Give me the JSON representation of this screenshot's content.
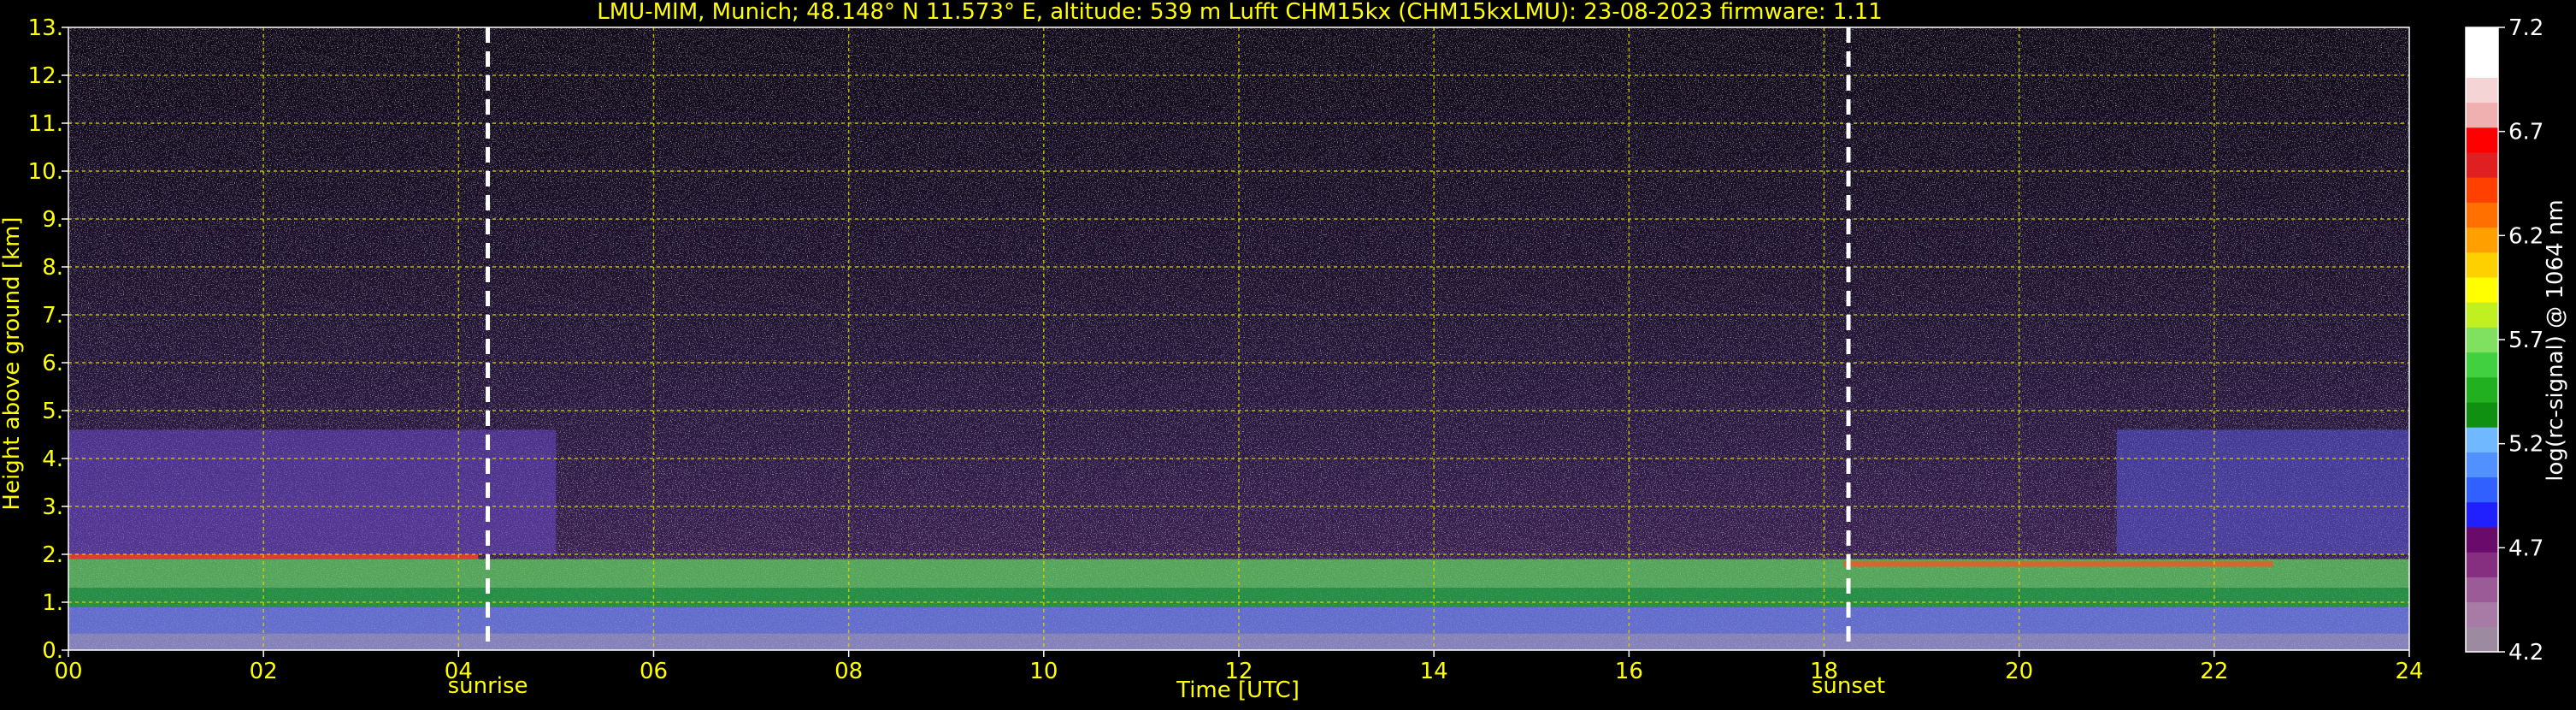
{
  "chart_data": {
    "type": "heatmap",
    "title": "LMU-MIM, Munich; 48.148° N 11.573° E, altitude: 539 m    Lufft CHM15kx (CHM15kxLMU): 23-08-2023    firmware: 1.11",
    "xlabel": "Time [UTC]",
    "ylabel": "Height above ground [km]",
    "xlim": [
      0,
      24
    ],
    "ylim": [
      0,
      13
    ],
    "x_ticks": [
      0,
      2,
      4,
      6,
      8,
      10,
      12,
      14,
      16,
      18,
      20,
      22,
      24
    ],
    "x_tick_labels": [
      "00",
      "02",
      "04",
      "06",
      "08",
      "10",
      "12",
      "14",
      "16",
      "18",
      "20",
      "22",
      "24"
    ],
    "y_ticks": [
      0,
      1,
      2,
      3,
      4,
      5,
      6,
      7,
      8,
      9,
      10,
      11,
      12,
      13
    ],
    "y_tick_labels": [
      "0.",
      "1.",
      "2.",
      "3.",
      "4.",
      "5.",
      "6.",
      "7.",
      "8.",
      "9.",
      "10.",
      "11.",
      "12.",
      "13."
    ],
    "grid": true,
    "colorbar": {
      "label": "log(rc-signal) @ 1064 nm",
      "range": [
        4.2,
        7.2
      ],
      "ticks": [
        4.2,
        4.7,
        5.2,
        5.7,
        6.2,
        6.7,
        7.2
      ],
      "tick_labels": [
        "4.2",
        "4.7",
        "5.2",
        "5.7",
        "6.2",
        "6.7",
        "7.2"
      ],
      "colors": [
        "#9c8ba0",
        "#a77ba6",
        "#9b5b97",
        "#862e80",
        "#6a0a6a",
        "#2020ff",
        "#3060ff",
        "#5090ff",
        "#70b8ff",
        "#109010",
        "#20b020",
        "#40d040",
        "#80e060",
        "#c0f020",
        "#ffff00",
        "#ffd000",
        "#ffa000",
        "#ff7000",
        "#ff4000",
        "#e02020",
        "#ff0000",
        "#f0b0b0",
        "#f4d4d4",
        "#ffffff",
        "#ffffff"
      ]
    },
    "markers": [
      {
        "x": 4.3,
        "label": "sunrise"
      },
      {
        "x": 18.25,
        "label": "sunset"
      }
    ],
    "colors": {
      "text": "#ffff00",
      "background": "#000000",
      "grid": "#d4d400",
      "marker_line": "#ffffff"
    }
  }
}
